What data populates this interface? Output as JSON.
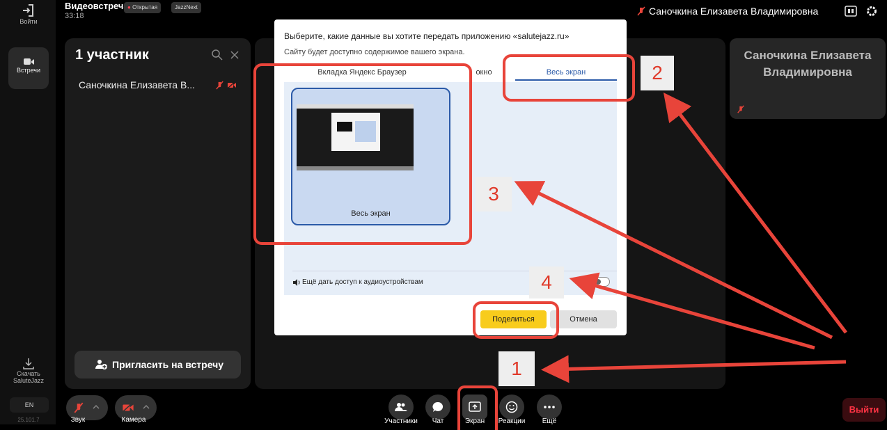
{
  "header": {
    "title": "Видеовстреча",
    "timer": "33:18",
    "badge_open": "Открытая",
    "badge_app": "JazzNext",
    "user_name": "Саночкина Елизавета Владимировна"
  },
  "rail": {
    "login": "Войти",
    "meetings": "Встречи",
    "download": "Скачать SaluteJazz",
    "lang": "EN",
    "version": "25.101.7"
  },
  "participants": {
    "title": "1 участник",
    "items": [
      {
        "name": "Саночкина Елизавета В..."
      }
    ],
    "invite_label": "Пригласить на встречу"
  },
  "tile": {
    "name": "Саночкина Елизавета Владимировна"
  },
  "toolbar": {
    "sound": "Звук",
    "camera": "Камера",
    "participants": "Участники",
    "chat": "Чат",
    "screen": "Экран",
    "reactions": "Реакции",
    "more": "Ещё",
    "exit": "Выйти"
  },
  "dialog": {
    "title": "Выберите, какие данные вы хотите передать приложению «salutejazz.ru»",
    "subtitle": "Сайту будет доступно содержимое вашего экрана.",
    "tabs": [
      {
        "label": "Вкладка Яндекс Браузер",
        "active": false
      },
      {
        "label": "окно",
        "active": false
      },
      {
        "label": "Весь экран",
        "active": true
      }
    ],
    "screen_card_label": "Весь экран",
    "audio_label": "Ещё дать доступ к аудиоустройствам",
    "audio_enabled": false,
    "share": "Поделиться",
    "cancel": "Отмена"
  },
  "annotations": [
    {
      "label": "1"
    },
    {
      "label": "2"
    },
    {
      "label": "3"
    },
    {
      "label": "4"
    }
  ],
  "colors": {
    "accent_red": "#e8443a",
    "share_yellow": "#f8cc1c",
    "tab_blue": "#2b5aa8",
    "exit_red": "#ff3344"
  }
}
